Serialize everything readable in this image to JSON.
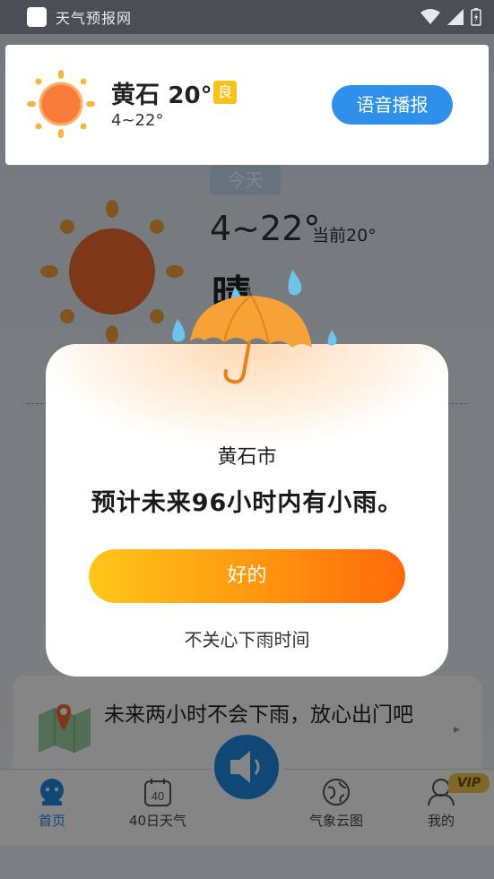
{
  "status_bar": {
    "app_name": "天气预报网"
  },
  "background": {
    "today_tab": "今天",
    "temp_range": "4~22°",
    "current_label": "当前20°",
    "condition": "晴",
    "rain_notice": "未来两小时不会下雨，放心出门吧",
    "arrow": "▸"
  },
  "top_card": {
    "city": "黄石",
    "temperature": "20°",
    "air_quality": "良",
    "temp_range": "4~22°",
    "voice_button": "语音播报"
  },
  "dialog": {
    "city": "黄石市",
    "message": "预计未来96小时内有小雨。",
    "ok_button": "好的",
    "dismiss_link": "不关心下雨时间"
  },
  "bottom_nav": {
    "items": [
      {
        "label": "首页",
        "icon": "home-icon",
        "active": true
      },
      {
        "label": "40日天气",
        "icon": "calendar-40-icon",
        "calendar_number": "40"
      },
      {
        "label": "气象云图",
        "icon": "globe-icon"
      },
      {
        "label": "我的",
        "icon": "user-icon"
      }
    ],
    "vip_badge": "VIP",
    "center_icon": "speaker-icon"
  },
  "colors": {
    "accent_blue": "#2e90ea",
    "aqi_yellow": "#f7c21c",
    "button_gradient_start": "#ffc61a",
    "button_gradient_end": "#ff6a0a"
  }
}
